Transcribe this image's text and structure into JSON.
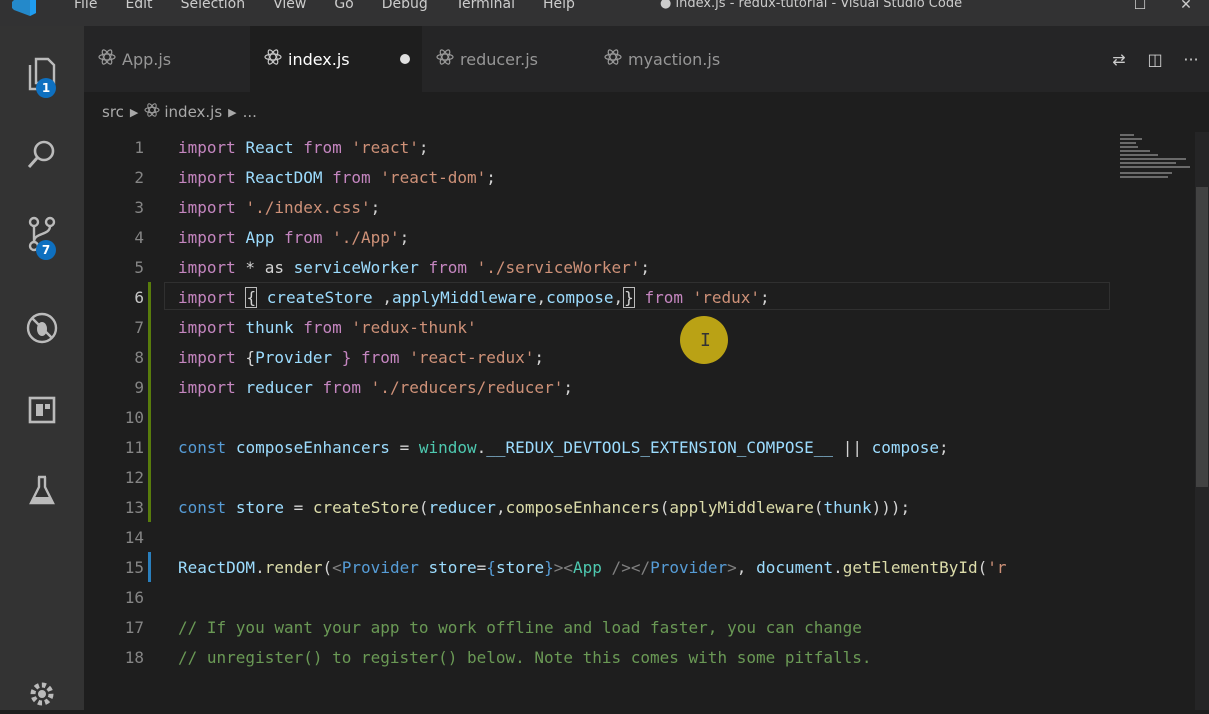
{
  "window": {
    "menu": [
      "File",
      "Edit",
      "Selection",
      "View",
      "Go",
      "Debug",
      "Terminal",
      "Help"
    ],
    "title": "● index.js - redux-tutorial - Visual Studio Code",
    "controls": {
      "maximize": "☐",
      "close": "✕"
    }
  },
  "activity_bar": {
    "explorer_badge": "1",
    "scm_badge": "7"
  },
  "tabs": [
    {
      "label": "App.js",
      "active": false,
      "dirty": false
    },
    {
      "label": "index.js",
      "active": true,
      "dirty": true
    },
    {
      "label": "reducer.js",
      "active": false,
      "dirty": false
    },
    {
      "label": "myaction.js",
      "active": false,
      "dirty": false
    }
  ],
  "tab_actions": {
    "compare": "⇄",
    "split": "◫",
    "more": "···"
  },
  "breadcrumb": {
    "folder": "src",
    "file": "index.js",
    "symbol": "..."
  },
  "editor": {
    "lines": [
      {
        "n": "1"
      },
      {
        "n": "2"
      },
      {
        "n": "3"
      },
      {
        "n": "4"
      },
      {
        "n": "5"
      },
      {
        "n": "6"
      },
      {
        "n": "7"
      },
      {
        "n": "8"
      },
      {
        "n": "9"
      },
      {
        "n": "10"
      },
      {
        "n": "11"
      },
      {
        "n": "12"
      },
      {
        "n": "13"
      },
      {
        "n": "14"
      },
      {
        "n": "15"
      },
      {
        "n": "16"
      },
      {
        "n": "17"
      },
      {
        "n": "18"
      }
    ],
    "code": {
      "l1": [
        "import",
        " ",
        "React",
        " from ",
        "'react'",
        ";"
      ],
      "l2": [
        "import",
        " ",
        "ReactDOM",
        " from ",
        "'react-dom'",
        ";"
      ],
      "l3": [
        "import",
        " ",
        "'./index.css'",
        ";"
      ],
      "l4": [
        "import",
        " ",
        "App",
        " from ",
        "'./App'",
        ";"
      ],
      "l5": [
        "import",
        " * as ",
        "serviceWorker",
        " from ",
        "'./serviceWorker'",
        ";"
      ],
      "l6": [
        "import",
        " ",
        "{",
        " ",
        "createStore",
        " ,",
        "applyMiddleware",
        ",",
        "compose",
        ",",
        "}",
        " from ",
        "'redux'",
        ";"
      ],
      "l7": [
        "import",
        " ",
        "thunk",
        " from ",
        "'redux-thunk'"
      ],
      "l8": [
        "import",
        " {",
        "Provider",
        " } from ",
        "'react-redux'",
        ";"
      ],
      "l9": [
        "import",
        " ",
        "reducer",
        " from ",
        "'./reducers/reducer'",
        ";"
      ],
      "l11": [
        "const",
        " ",
        "composeEnhancers",
        " = ",
        "window",
        ".",
        "__REDUX_DEVTOOLS_EXTENSION_COMPOSE__",
        " || ",
        "compose",
        ";"
      ],
      "l13": [
        "const",
        " ",
        "store",
        " = ",
        "createStore",
        "(",
        "reducer",
        ",",
        "composeEnhancers",
        "(",
        "applyMiddleware",
        "(",
        "thunk",
        ")));"
      ],
      "l15": [
        "ReactDOM",
        ".",
        "render",
        "(",
        "<",
        "Provider",
        " ",
        "store",
        "=",
        "{",
        "store",
        "}",
        "><",
        "App",
        " />",
        "</",
        "Provider",
        ">",
        ", ",
        "document",
        ".",
        "getElementById",
        "(",
        "'r"
      ],
      "l17": "// If you want your app to work offline and load faster, you can change",
      "l18": "// unregister() to register() below. Note this comes with some pitfalls."
    }
  },
  "cursor_glyph": "I"
}
